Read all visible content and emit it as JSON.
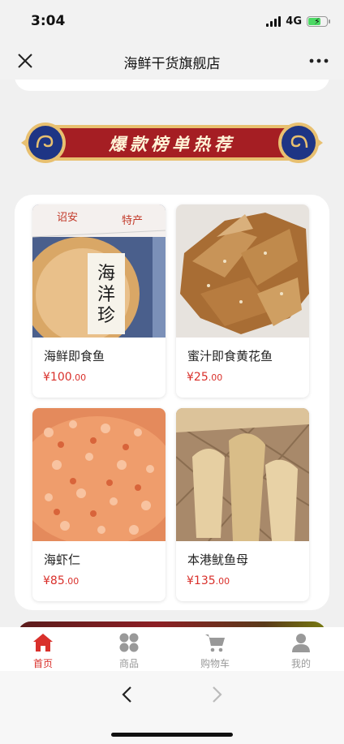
{
  "status_bar": {
    "time": "3:04",
    "network": "4G",
    "battery_level": 0.7
  },
  "nav": {
    "title": "海鲜干货旗舰店"
  },
  "banner": {
    "text": "爆款榜单热荐",
    "color": "#a51e23",
    "accent": "#e8c070"
  },
  "products": [
    {
      "name": "海鲜即食鱼",
      "currency": "¥",
      "price_int": "100",
      "price_dec": ".00",
      "image": "dried-fish-bag-image",
      "image_text": "诏安 特产 海洋珍品"
    },
    {
      "name": "蜜汁即食黄花鱼",
      "currency": "¥",
      "price_int": "25",
      "price_dec": ".00",
      "image": "honey-fish-image"
    },
    {
      "name": "海虾仁",
      "currency": "¥",
      "price_int": "85",
      "price_dec": ".00",
      "image": "dried-shrimp-image"
    },
    {
      "name": "本港鱿鱼母",
      "currency": "¥",
      "price_int": "135",
      "price_dec": ".00",
      "image": "dried-squid-image"
    }
  ],
  "tabbar": {
    "items": [
      {
        "label": "首页",
        "icon": "home-icon",
        "active": true
      },
      {
        "label": "商品",
        "icon": "grid-icon",
        "active": false
      },
      {
        "label": "购物车",
        "icon": "cart-icon",
        "active": false
      },
      {
        "label": "我的",
        "icon": "user-icon",
        "active": false
      }
    ]
  },
  "colors": {
    "price": "#d9302b",
    "active_tab": "#d9302b",
    "inactive_tab": "#999999"
  }
}
